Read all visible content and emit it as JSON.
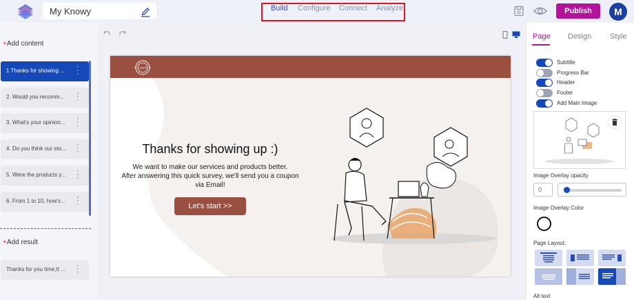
{
  "topbar": {
    "project_name": "My Knowy",
    "tabs": [
      {
        "label": "Build",
        "active": true
      },
      {
        "label": "Configure",
        "active": false
      },
      {
        "label": "Connect",
        "active": false
      },
      {
        "label": "Analyze",
        "active": false
      }
    ],
    "publish_label": "Publish",
    "avatar_initial": "M",
    "icons": [
      "layers-logo-icon",
      "pencil-icon",
      "save-icon",
      "eye-icon"
    ]
  },
  "left_panel": {
    "add_content": {
      "plus": "+",
      "label": "Add content"
    },
    "questions": [
      {
        "label": "1 Thanks for showing ...",
        "active": true
      },
      {
        "label": "2. Would you recomm...",
        "active": false
      },
      {
        "label": "3. What's your opinion...",
        "active": false
      },
      {
        "label": "4. Do you think our sto...",
        "active": false
      },
      {
        "label": "5. Were the products y...",
        "active": false
      },
      {
        "label": "6. From 1 to 10, how's...",
        "active": false
      }
    ],
    "add_result": {
      "plus": "+",
      "label": "Add result"
    },
    "results": [
      {
        "label": "Thanks for you time,It ..."
      }
    ]
  },
  "canvas": {
    "device_icons": [
      "undo-icon",
      "redo-icon",
      "mobile-icon",
      "desktop-icon"
    ],
    "page": {
      "logo_text": "LOGO",
      "heading": "Thanks for showing up :)",
      "text_line1": "We want to make our services and products better.",
      "text_line2": "After answering this quick survey, we'll send you a coupon",
      "text_line3": "via Email!",
      "cta_label": "Let's start >>"
    }
  },
  "right_panel": {
    "tabs": [
      {
        "label": "Page",
        "active": true
      },
      {
        "label": "Design",
        "active": false
      },
      {
        "label": "Style",
        "active": false
      }
    ],
    "toggles": [
      {
        "label": "Subtitle",
        "on": true
      },
      {
        "label": "Progress Bar",
        "on": false
      },
      {
        "label": "Header",
        "on": true
      },
      {
        "label": "Footer",
        "on": false
      },
      {
        "label": "Add Main Image",
        "on": true
      }
    ],
    "overlay_opacity_label": "Image Overlay opacity",
    "overlay_opacity_value": "0",
    "overlay_color_label": "Image Overlay Color",
    "page_layout_label": "Page Layout:",
    "alt_text_label": "Alt text"
  },
  "colors": {
    "accent": "#1649b8",
    "brand": "#b3139a",
    "header_brown": "#9a4f40",
    "highlight_box": "#e0141e"
  }
}
